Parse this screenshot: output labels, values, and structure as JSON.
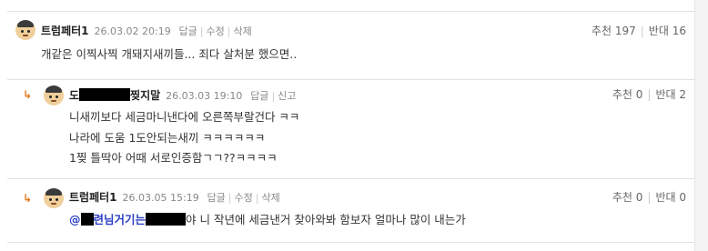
{
  "comments": [
    {
      "nickname": "트럼페터1",
      "date": "26.03.02 20:19",
      "actions": [
        "답글",
        "수정",
        "삭제"
      ],
      "recommend_label": "추천",
      "recommend_count": "197",
      "oppose_label": "반대",
      "oppose_count": "16",
      "lines": [
        "개같은 이찍사찍 개돼지새끼들... 죄다 살처분 했으면.."
      ]
    },
    {
      "nickname_prefix": "도",
      "nickname_suffix": "찢지말",
      "date": "26.03.03 19:10",
      "actions": [
        "답글",
        "신고"
      ],
      "recommend_label": "추천",
      "recommend_count": "0",
      "oppose_label": "반대",
      "oppose_count": "2",
      "lines": [
        "니새끼보다 세금마니낸다에 오른쪽부랄건다 ㅋㅋ",
        "나라에 도움 1도안되는새끼 ㅋㅋㅋㅋㅋㅋ",
        "1찢 틀딱아 어때 서로인증함ㄱㄱ??ㅋㅋㅋㅋ"
      ]
    },
    {
      "nickname": "트럼페터1",
      "date": "26.03.05 15:19",
      "actions": [
        "답글",
        "수정",
        "삭제"
      ],
      "recommend_label": "추천",
      "recommend_count": "0",
      "oppose_label": "반대",
      "oppose_count": "0",
      "mention_at": "@",
      "mention_text": "련님거기는",
      "body_rest": "야 니 작년에 세금낸거 찾아와봐 함보자 얼마나 많이 내는가"
    }
  ],
  "icons": {
    "reply_arrow": "↳",
    "avatar": "avatar-icon"
  },
  "colors": {
    "mention": "#2b3fc4",
    "reply_arrow": "#e07a1a",
    "redaction": "#000000"
  }
}
